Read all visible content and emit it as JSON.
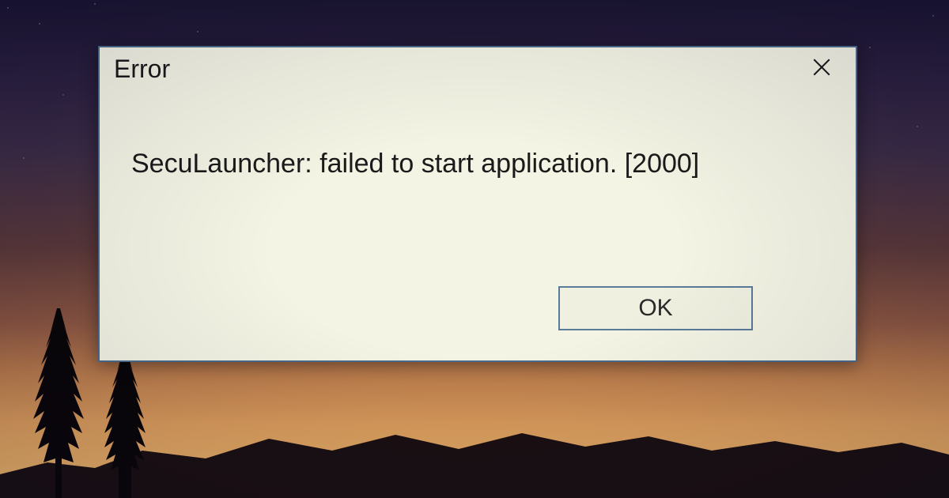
{
  "dialog": {
    "title": "Error",
    "message": "SecuLauncher: failed to start application. [2000]",
    "ok_label": "OK"
  }
}
